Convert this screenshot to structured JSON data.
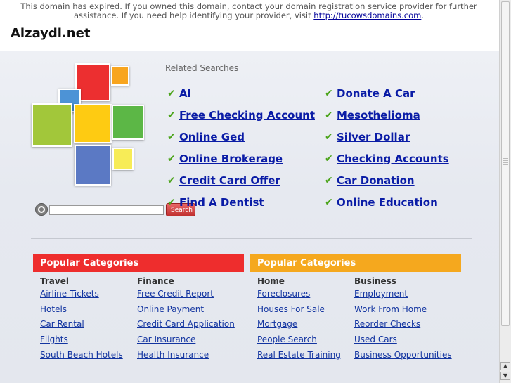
{
  "notice": {
    "text": "This domain has expired. If you owned this domain, contact your domain registration service provider for further assistance. If you need help identifying your provider, visit ",
    "link": "http://tucowsdomains.com",
    "trailing": "."
  },
  "site_title": "Alzaydi.net",
  "search": {
    "placeholder": "",
    "value": "",
    "button_label": "Search"
  },
  "related": {
    "title": "Related Searches",
    "left": [
      "AI",
      "Free Checking Account",
      "Online Ged",
      "Online Brokerage",
      "Credit Card Offer",
      "Find A Dentist"
    ],
    "right": [
      "Donate A Car",
      "Mesothelioma",
      "Silver Dollar",
      "Checking Accounts",
      "Car Donation",
      "Online Education"
    ]
  },
  "categories": [
    {
      "header": "Popular Categories",
      "color": "#ee2d2d",
      "columns": [
        {
          "title": "Travel",
          "links": [
            "Airline Tickets",
            "Hotels",
            "Car Rental",
            "Flights",
            "South Beach Hotels"
          ]
        },
        {
          "title": "Finance",
          "links": [
            "Free Credit Report",
            "Online Payment",
            "Credit Card Application",
            "Car Insurance",
            "Health Insurance"
          ]
        }
      ]
    },
    {
      "header": "Popular Categories",
      "color": "#f5a81e",
      "columns": [
        {
          "title": "Home",
          "links": [
            "Foreclosures",
            "Houses For Sale",
            "Mortgage",
            "People Search",
            "Real Estate Training"
          ]
        },
        {
          "title": "Business",
          "links": [
            "Employment",
            "Work From Home",
            "Reorder Checks",
            "Used Cars",
            "Business Opportunities"
          ]
        }
      ]
    }
  ],
  "colors": {
    "link": "#0a1ca6",
    "check": "#4ba41a",
    "logo_red": "#ec2f30",
    "logo_orange": "#f8a51f",
    "logo_blue": "#4d93d6",
    "logo_lime": "#a2c73a",
    "logo_yellow": "#fecb12",
    "logo_green": "#5cb746",
    "logo_navy": "#5b79c4",
    "logo_paleyellow": "#f7ec57"
  }
}
